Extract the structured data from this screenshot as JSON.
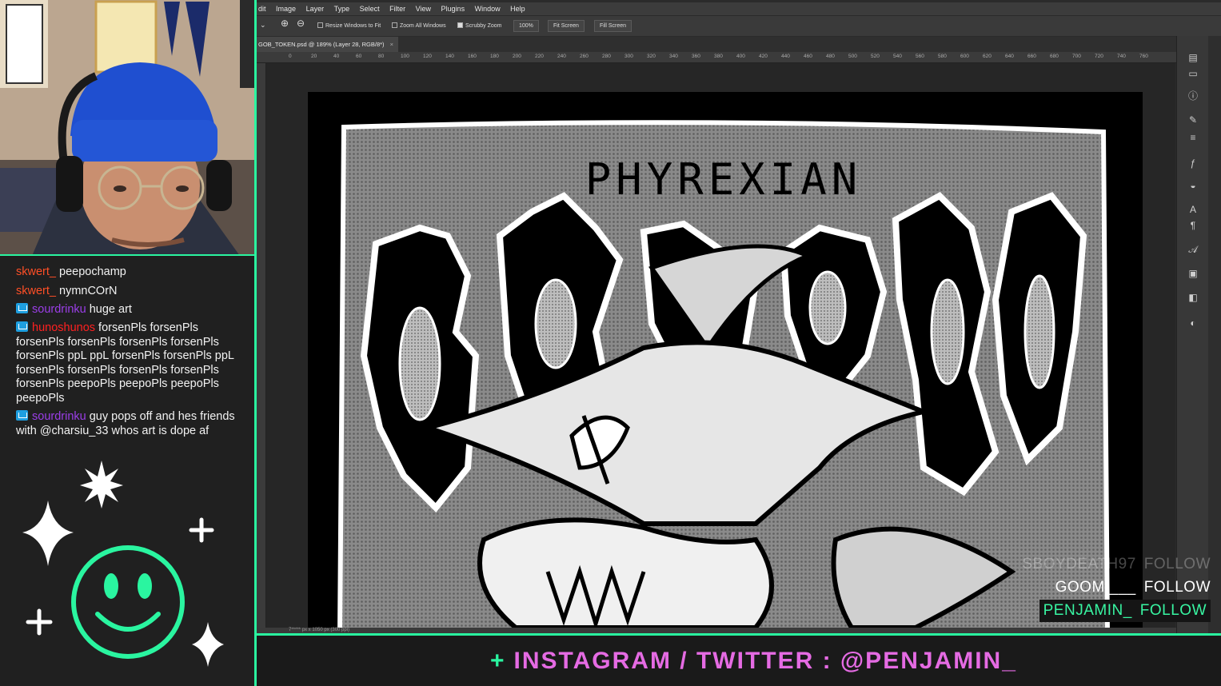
{
  "chat": {
    "messages": [
      {
        "user": "skwert_",
        "user_color": "#ff4f26",
        "badge": false,
        "text": "peepochamp"
      },
      {
        "user": "skwert_",
        "user_color": "#ff4f26",
        "badge": false,
        "text": "nymnCOrN"
      },
      {
        "user": "sourdrinku",
        "user_color": "#9b3ee8",
        "badge": true,
        "text": "huge art"
      },
      {
        "user": "hunoshunos",
        "user_color": "#ff2020",
        "badge": true,
        "text": "forsenPls forsenPls forsenPls forsenPls forsenPls forsenPls forsenPls ppL ppL forsenPls forsenPls ppL forsenPls forsenPls forsenPls forsenPls forsenPls peepoPls peepoPls peepoPls peepoPls"
      },
      {
        "user": "sourdrinku",
        "user_color": "#9b3ee8",
        "badge": true,
        "text": "guy pops off and hes friends with @charsiu_33 whos art is dope af"
      }
    ]
  },
  "photoshop": {
    "menu": [
      "dit",
      "Image",
      "Layer",
      "Type",
      "Select",
      "Filter",
      "View",
      "Plugins",
      "Window",
      "Help"
    ],
    "options": {
      "resize_windows": "Resize Windows to Fit",
      "zoom_all": "Zoom All Windows",
      "scrubby_zoom": "Scrubby Zoom",
      "zoom_value": "100%",
      "fit_screen": "Fit Screen",
      "fill_screen": "Fill Screen"
    },
    "doc_tab": "GOB_TOKEN.psd @ 189% (Layer 28, RGB/8*)",
    "ruler_ticks": [
      "0",
      "20",
      "40",
      "60",
      "80",
      "100",
      "120",
      "140",
      "160",
      "180",
      "200",
      "220",
      "240",
      "260",
      "280",
      "300",
      "320",
      "340",
      "360",
      "380",
      "400",
      "420",
      "440",
      "460",
      "480",
      "500",
      "520",
      "540",
      "560",
      "580",
      "600",
      "620",
      "640",
      "660",
      "680",
      "700",
      "720",
      "740",
      "760"
    ],
    "status": "7***** px x 1050 px (300 ppi)"
  },
  "artwork": {
    "title": "PHYREXIAN"
  },
  "follows": [
    {
      "name": "SBOYDEATH97",
      "action": "FOLLOW",
      "state": "faded"
    },
    {
      "name": "GOOMI___",
      "action": "FOLLOW",
      "state": "normal"
    },
    {
      "name": "PENJAMIN_",
      "action": "FOLLOW",
      "state": "highlight"
    }
  ],
  "banner": {
    "plus": "+",
    "text": "INSTAGRAM / TWITTER : @PENJAMIN_"
  },
  "colors": {
    "neon_green": "#2af5a0",
    "neon_pink": "#e56be3"
  }
}
